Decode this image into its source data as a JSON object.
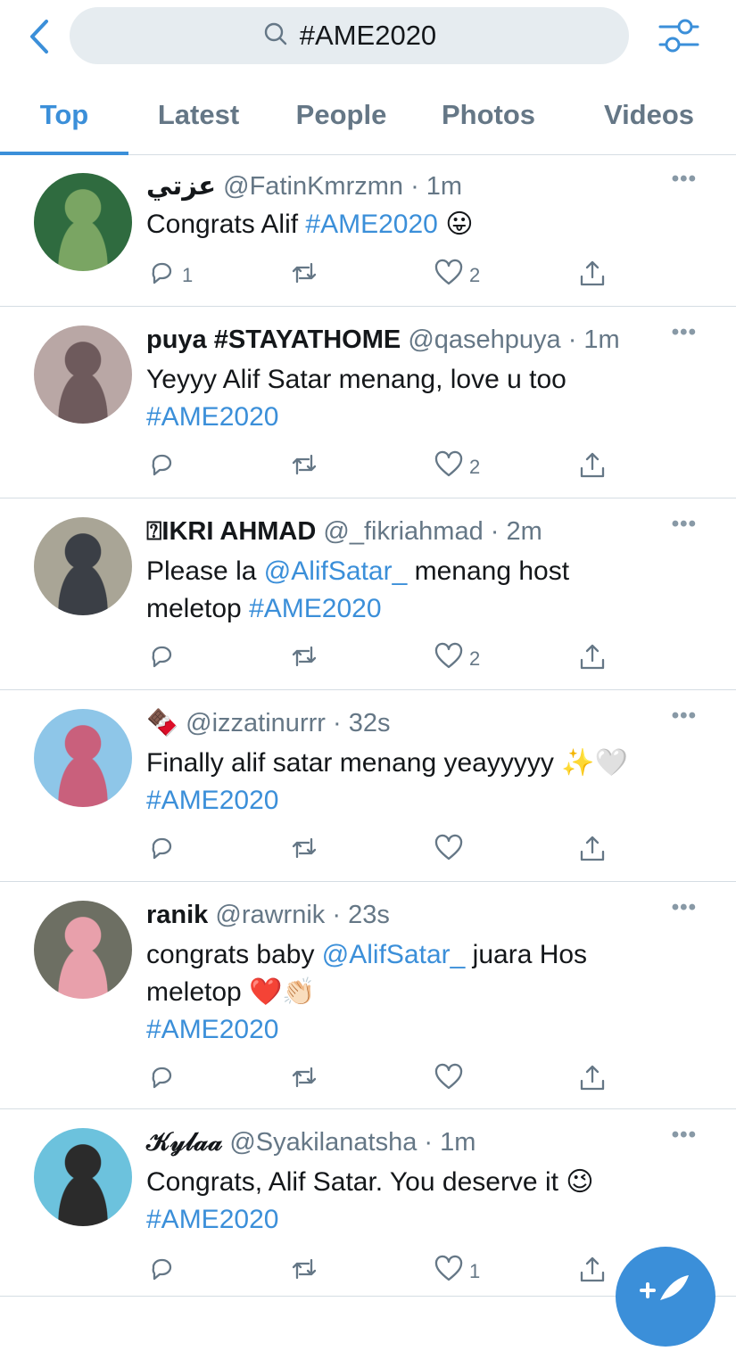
{
  "search": {
    "query": "#AME2020"
  },
  "tabs": [
    "Top",
    "Latest",
    "People",
    "Photos",
    "Videos"
  ],
  "colors": {
    "accent": "#3b8fd9",
    "muted": "#657786",
    "divider": "#d5dde3"
  },
  "tweets": [
    {
      "display_name": "عزتي",
      "handle": "@FatinKmrzmn",
      "time": "· 1m",
      "body_parts": [
        {
          "text": "Congrats Alif ",
          "tag": false
        },
        {
          "text": "#AME2020",
          "tag": true
        },
        {
          "text": " 😛",
          "tag": false
        }
      ],
      "replies": "1",
      "retweets": "",
      "likes": "2"
    },
    {
      "display_name": "puya #STAYATHOME",
      "handle": "@qasehpuya",
      "time": "· 1m",
      "body_parts": [
        {
          "text": "Yeyyy Alif Satar menang, love u too\n",
          "tag": false
        },
        {
          "text": "#AME2020",
          "tag": true
        }
      ],
      "replies": "",
      "retweets": "",
      "likes": "2"
    },
    {
      "display_name": "⍰IKRI AHMAD",
      "handle": "@_fikriahmad",
      "time": "· 2m",
      "body_parts": [
        {
          "text": "Please la ",
          "tag": false
        },
        {
          "text": "@AlifSatar_",
          "tag": true
        },
        {
          "text": "  menang host\nmeletop ",
          "tag": false
        },
        {
          "text": "#AME2020",
          "tag": true
        }
      ],
      "replies": "",
      "retweets": "",
      "likes": "2"
    },
    {
      "display_name": "🍫",
      "handle": "@izzatinurrr",
      "time": "· 32s",
      "body_parts": [
        {
          "text": "Finally alif satar menang yeayyyyy ✨🤍\n",
          "tag": false
        },
        {
          "text": "#AME2020",
          "tag": true
        }
      ],
      "replies": "",
      "retweets": "",
      "likes": ""
    },
    {
      "display_name": "ranik",
      "handle": "@rawrnik",
      "time": "· 23s",
      "body_parts": [
        {
          "text": "congrats baby ",
          "tag": false
        },
        {
          "text": "@AlifSatar_",
          "tag": true
        },
        {
          "text": "  juara Hos\nmeletop ❤️👏🏻\n",
          "tag": false
        },
        {
          "text": "#AME2020",
          "tag": true
        }
      ],
      "replies": "",
      "retweets": "",
      "likes": ""
    },
    {
      "display_name": "𝒦𝓎𝓁𝒶𝒶",
      "handle": "@Syakilanatsha",
      "time": "· 1m",
      "body_parts": [
        {
          "text": "Congrats, Alif Satar. You deserve it 😉\n",
          "tag": false
        },
        {
          "text": "#AME2020",
          "tag": true
        }
      ],
      "replies": "",
      "retweets": "",
      "likes": "1"
    }
  ]
}
